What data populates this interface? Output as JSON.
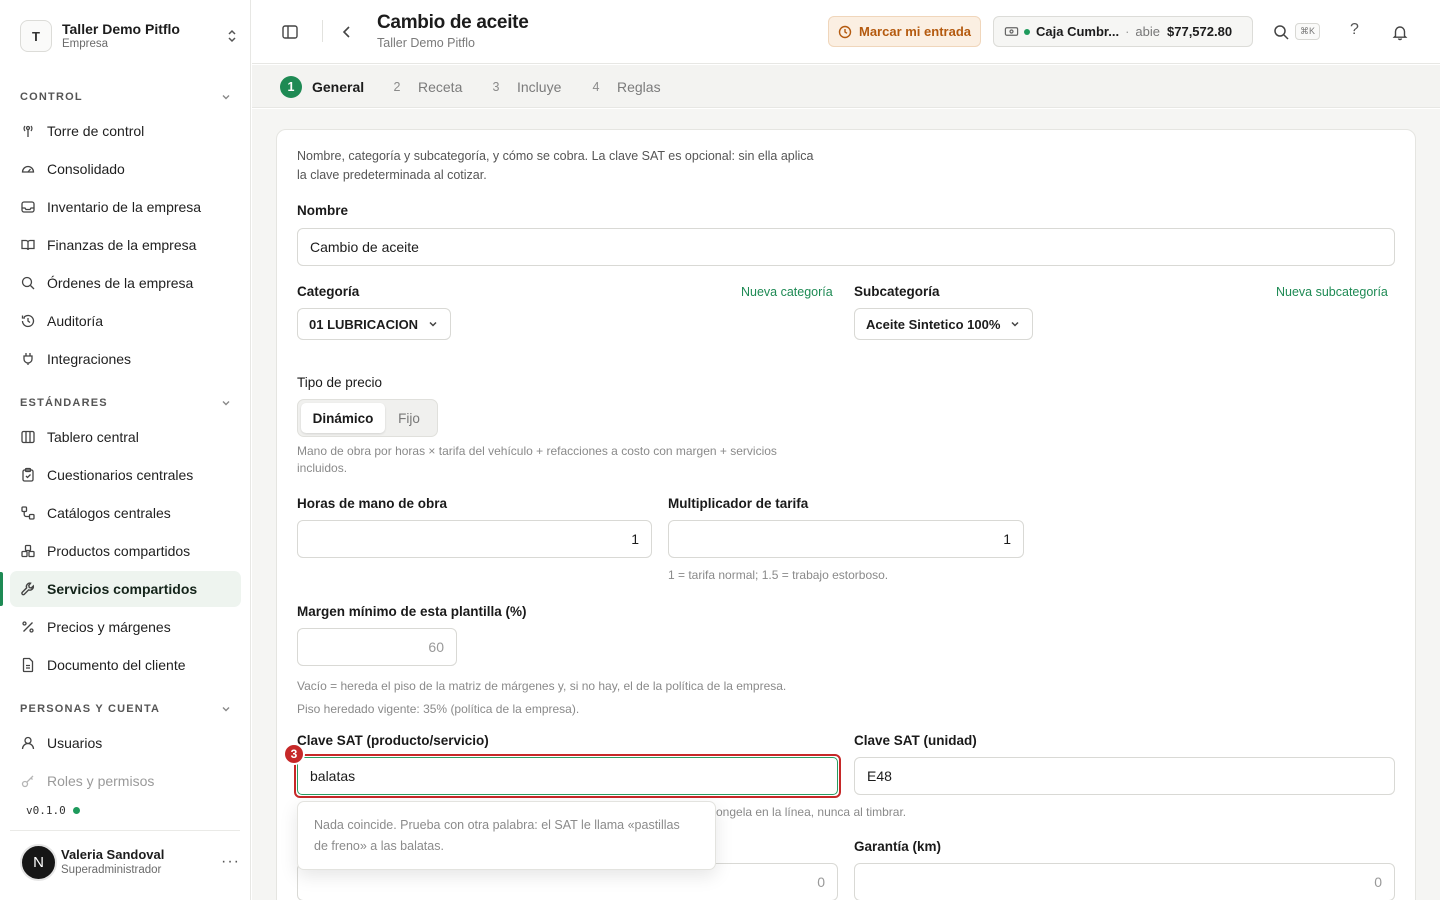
{
  "org": {
    "initial": "T",
    "name": "Taller Demo Pitflo",
    "type": "Empresa"
  },
  "sidebar": {
    "sections": [
      {
        "title": "CONTROL"
      },
      {
        "title": "ESTÁNDARES"
      },
      {
        "title": "PERSONAS Y CUENTA"
      }
    ],
    "control": [
      {
        "label": "Torre de control",
        "icon": "tower-icon"
      },
      {
        "label": "Consolidado",
        "icon": "gauge-icon"
      },
      {
        "label": "Inventario de la empresa",
        "icon": "inbox-icon"
      },
      {
        "label": "Finanzas de la empresa",
        "icon": "book-icon"
      },
      {
        "label": "Órdenes de la empresa",
        "icon": "search-icon"
      },
      {
        "label": "Auditoría",
        "icon": "history-icon"
      },
      {
        "label": "Integraciones",
        "icon": "plug-icon"
      }
    ],
    "estandares": [
      {
        "label": "Tablero central",
        "icon": "columns-icon"
      },
      {
        "label": "Cuestionarios centrales",
        "icon": "clipboard-icon"
      },
      {
        "label": "Catálogos centrales",
        "icon": "workflow-icon"
      },
      {
        "label": "Productos compartidos",
        "icon": "boxes-icon"
      },
      {
        "label": "Servicios compartidos",
        "icon": "wrench-icon",
        "active": true
      },
      {
        "label": "Precios y márgenes",
        "icon": "percent-icon"
      },
      {
        "label": "Documento del cliente",
        "icon": "file-icon"
      }
    ],
    "personas": [
      {
        "label": "Usuarios",
        "icon": "user-icon"
      },
      {
        "label": "Roles y permisos",
        "icon": "key-icon"
      }
    ],
    "version": "v0.1.0"
  },
  "user": {
    "initial": "N",
    "name": "Valeria Sandoval",
    "role": "Superadministrador",
    "more": "···"
  },
  "header": {
    "title": "Cambio de aceite",
    "subtitle": "Taller Demo Pitflo",
    "entry_button": "Marcar mi entrada",
    "cash": {
      "name": "Caja Cumbr...",
      "separator": "·",
      "status": "abie",
      "amount": "$77,572.80"
    },
    "shortcut": "⌘K",
    "help": "?"
  },
  "steps": [
    {
      "num": "1",
      "label": "General",
      "active": true
    },
    {
      "num": "2",
      "label": "Receta"
    },
    {
      "num": "3",
      "label": "Incluye"
    },
    {
      "num": "4",
      "label": "Reglas"
    }
  ],
  "form": {
    "intro_line1": "Nombre, categoría y subcategoría, y cómo se cobra. La clave SAT es opcional: sin ella aplica",
    "intro_line2": "la clave predeterminada al cotizar.",
    "nombre_label": "Nombre",
    "nombre_value": "Cambio de aceite",
    "categoria_label": "Categoría",
    "categoria_link": "Nueva categoría",
    "categoria_value": "01 LUBRICACION",
    "subcategoria_label": "Subcategoría",
    "subcategoria_link": "Nueva subcategoría",
    "subcategoria_value": "Aceite Sintetico 100%",
    "tipo_label": "Tipo de precio",
    "tipo_options": [
      "Dinámico",
      "Fijo"
    ],
    "tipo_help_line1": "Mano de obra por horas × tarifa del vehículo + refacciones a costo con margen + servicios",
    "tipo_help_line2": "incluidos.",
    "horas_label": "Horas de mano de obra",
    "horas_value": "1",
    "mult_label": "Multiplicador de tarifa",
    "mult_value": "1",
    "mult_help": "1 = tarifa normal; 1.5 = trabajo estorboso.",
    "margen_label": "Margen mínimo de esta plantilla (%)",
    "margen_placeholder": "60",
    "margen_help1": "Vacío = hereda el piso de la matriz de márgenes y, si no hay, el de la política de la empresa.",
    "margen_help2": "Piso heredado vigente: 35% (política de la empresa).",
    "sat_label": "Clave SAT (producto/servicio)",
    "sat_value": "balatas",
    "sat_badge": "3",
    "sat_unit_label": "Clave SAT (unidad)",
    "sat_unit_value": "E48",
    "sat_help_partial": "ongela en la línea, nunca al timbrar.",
    "dropdown_line1": "Nada coincide. Prueba con otra palabra: el SAT le llama «pastillas",
    "dropdown_line2": "de freno» a las balatas.",
    "garantia_label": "Garantía (km)",
    "bottom_left_value": "0",
    "garantia_value": "0"
  },
  "colors": {
    "accent": "#1e8a54",
    "focus_ring": "#c62828",
    "warning_bg": "#fbefe2"
  }
}
